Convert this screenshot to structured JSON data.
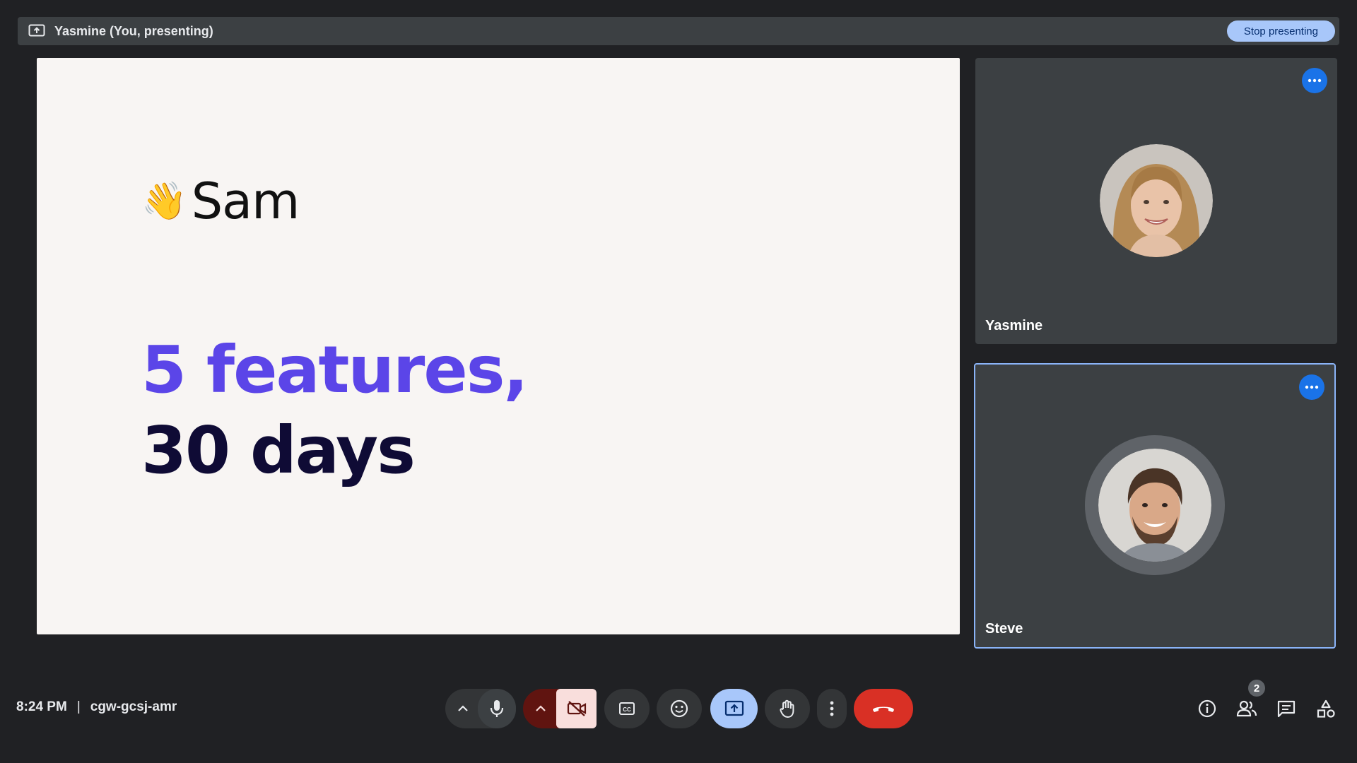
{
  "presenting_bar": {
    "title": "Yasmine (You, presenting)",
    "stop_label": "Stop presenting",
    "icon": "present-screen-icon"
  },
  "slide": {
    "logo_emoji": "👋",
    "logo_text": "Sam",
    "headline_line1": "5 features,",
    "headline_line2": "30 days",
    "colors": {
      "line1": "#5b45e8",
      "line2": "#0f0b35",
      "background": "#f8f5f3"
    }
  },
  "participants": [
    {
      "name": "Yasmine",
      "more_icon": "more-horiz-icon"
    },
    {
      "name": "Steve",
      "more_icon": "more-horiz-icon",
      "active_speaker": true
    }
  ],
  "meeting": {
    "time": "8:24 PM",
    "separator": "|",
    "code": "cgw-gcsj-amr"
  },
  "controls": {
    "audio_options_icon": "chevron-up-icon",
    "mic_icon": "mic-icon",
    "video_options_icon": "chevron-up-icon",
    "camera_icon": "videocam-off-icon",
    "captions_icon": "closed-captions-icon",
    "reactions_icon": "emoji-icon",
    "present_icon": "present-screen-icon",
    "raise_hand_icon": "hand-icon",
    "more_icon": "more-vert-icon",
    "leave_icon": "call-end-icon"
  },
  "side_controls": {
    "info_icon": "info-icon",
    "people_icon": "people-icon",
    "people_count": "2",
    "chat_icon": "chat-icon",
    "activities_icon": "activities-icon"
  },
  "colors": {
    "accent": "#a8c7fa",
    "leave_red": "#d93025",
    "camera_off_bg": "#f9dedc",
    "camera_off_dark": "#601410",
    "tile_bg": "#3c4043",
    "page_bg": "#202124"
  }
}
